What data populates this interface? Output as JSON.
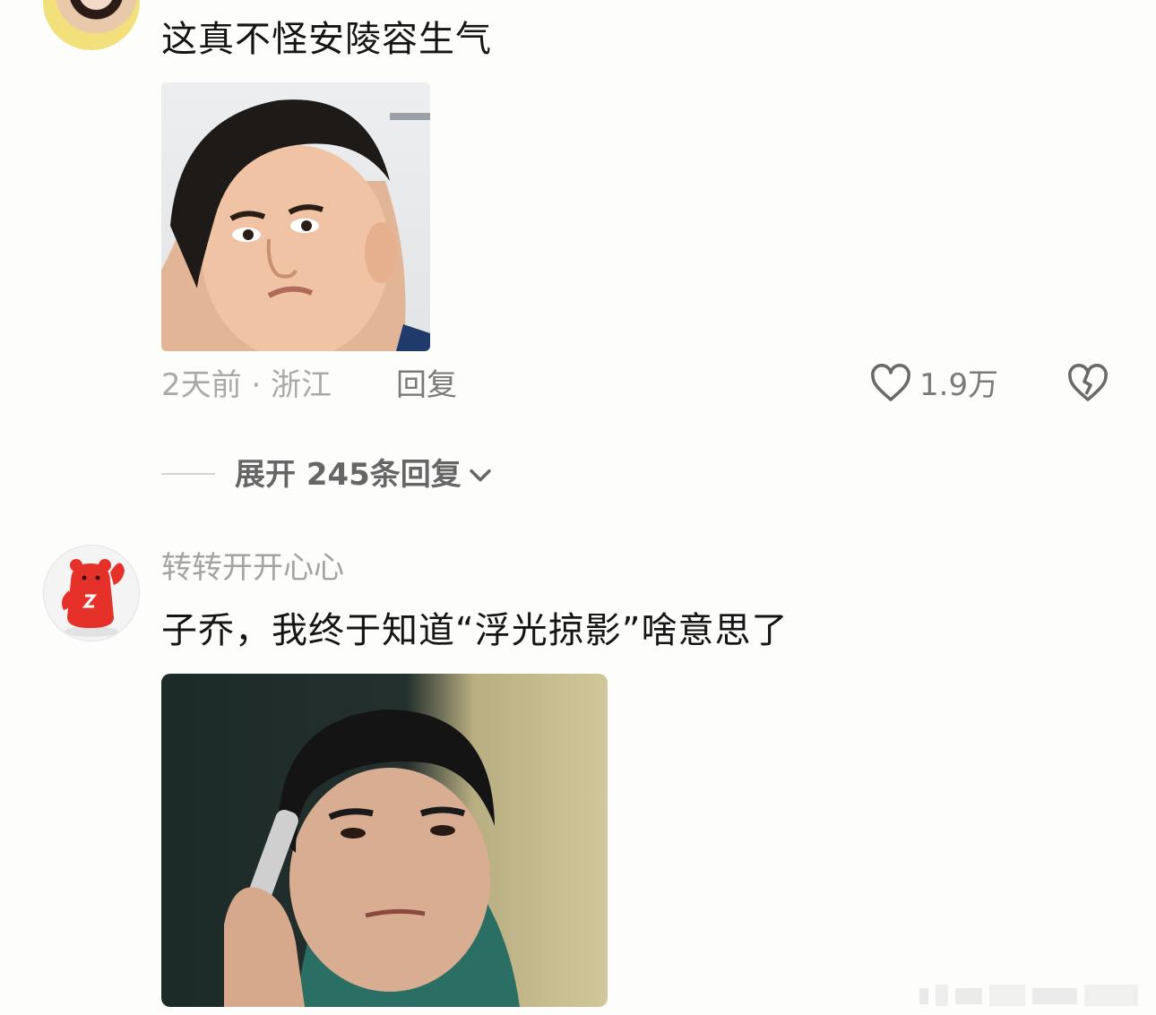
{
  "comment1": {
    "text": "这真不怪安陵容生气",
    "meta": "2天前 · 浙江",
    "reply_label": "回复",
    "likes": "1.9万",
    "expand_label": "展开 245条回复"
  },
  "comment2": {
    "username": "转转开开心心",
    "text": "子乔，我终于知道“浮光掠影”啥意思了"
  },
  "icons": {
    "like": "heart-outline-icon",
    "dislike": "broken-heart-icon",
    "expand": "chevron-down-icon"
  }
}
